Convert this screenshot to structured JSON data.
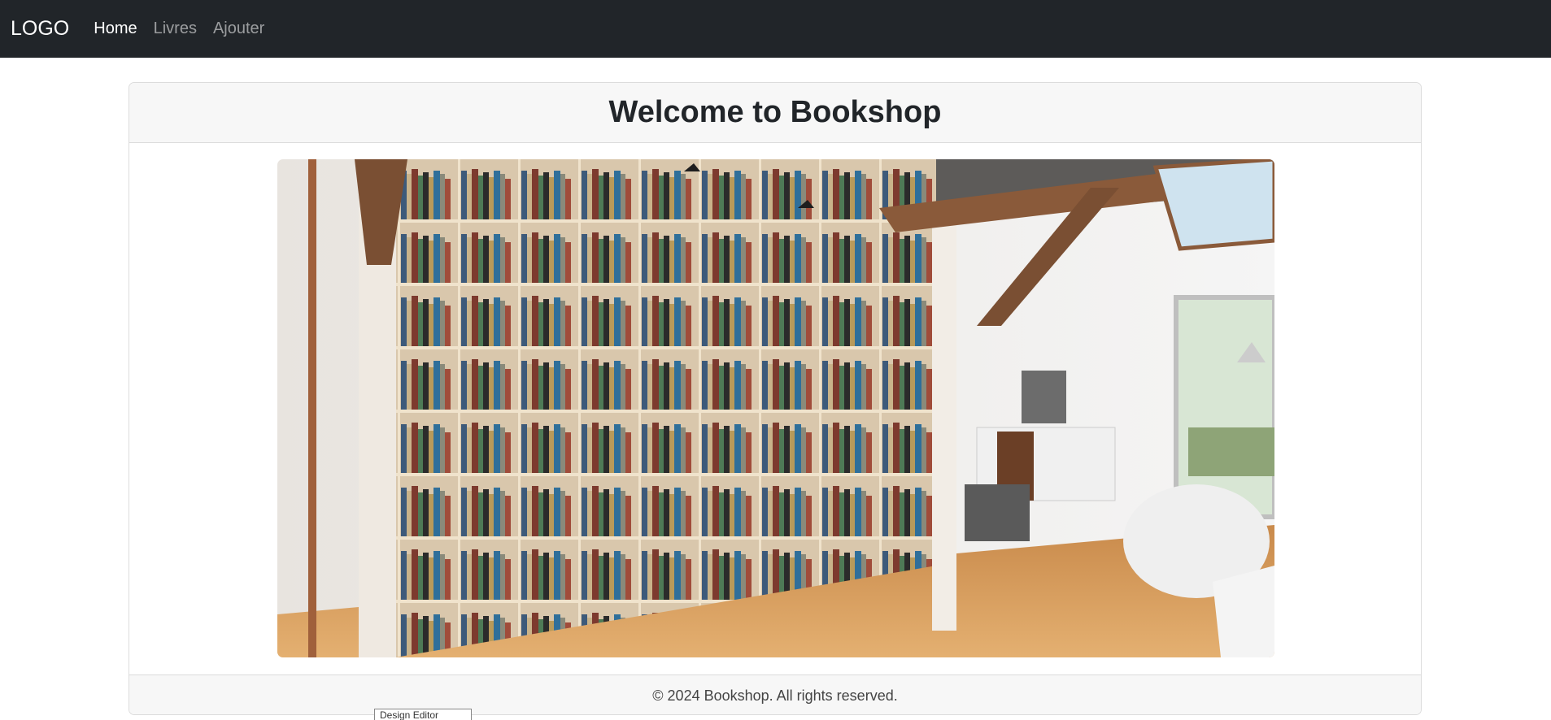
{
  "navbar": {
    "brand": "LOGO",
    "links": [
      {
        "label": "Home",
        "active": true
      },
      {
        "label": "Livres",
        "active": false
      },
      {
        "label": "Ajouter",
        "active": false
      }
    ],
    "background": "#212529"
  },
  "main": {
    "title": "Welcome to Bookshop",
    "hero_image": "library-bookshelf-room"
  },
  "footer": {
    "text": "© 2024 Bookshop. All rights reserved."
  },
  "tooltip": {
    "text": "Design Editor"
  }
}
